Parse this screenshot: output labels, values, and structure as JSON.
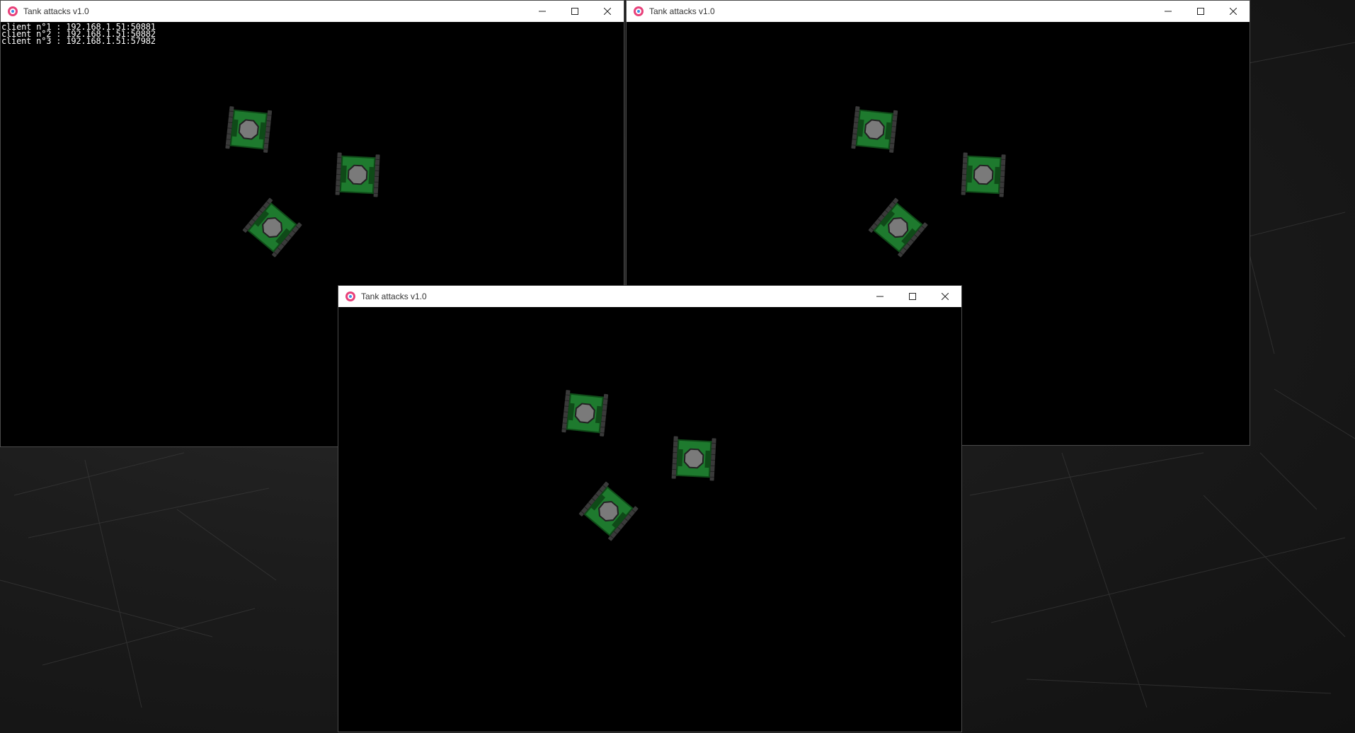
{
  "desktop": {
    "background_color": "#1a1a1a"
  },
  "windows": [
    {
      "title": "Tank attacks v1.0",
      "client_list": [
        "client n°1 : 192.168.1.51:50881",
        "client n°2 : 192.168.1.51:50882",
        "client n°3 : 192.168.1.51:57982"
      ]
    },
    {
      "title": "Tank attacks v1.0"
    },
    {
      "title": "Tank attacks v1.0"
    }
  ],
  "colors": {
    "tank_body": "#1e7a2e",
    "tank_dark": "#0f4a18",
    "tank_treads": "#3a3a3a",
    "turret": "#7a7a7a",
    "app_icon_pink": "#e8417a",
    "app_icon_blue": "#3a8ee6"
  },
  "icons": {
    "app": "tank-attacks-app-icon",
    "minimize": "minimize-icon",
    "maximize": "maximize-icon",
    "close": "close-icon"
  }
}
